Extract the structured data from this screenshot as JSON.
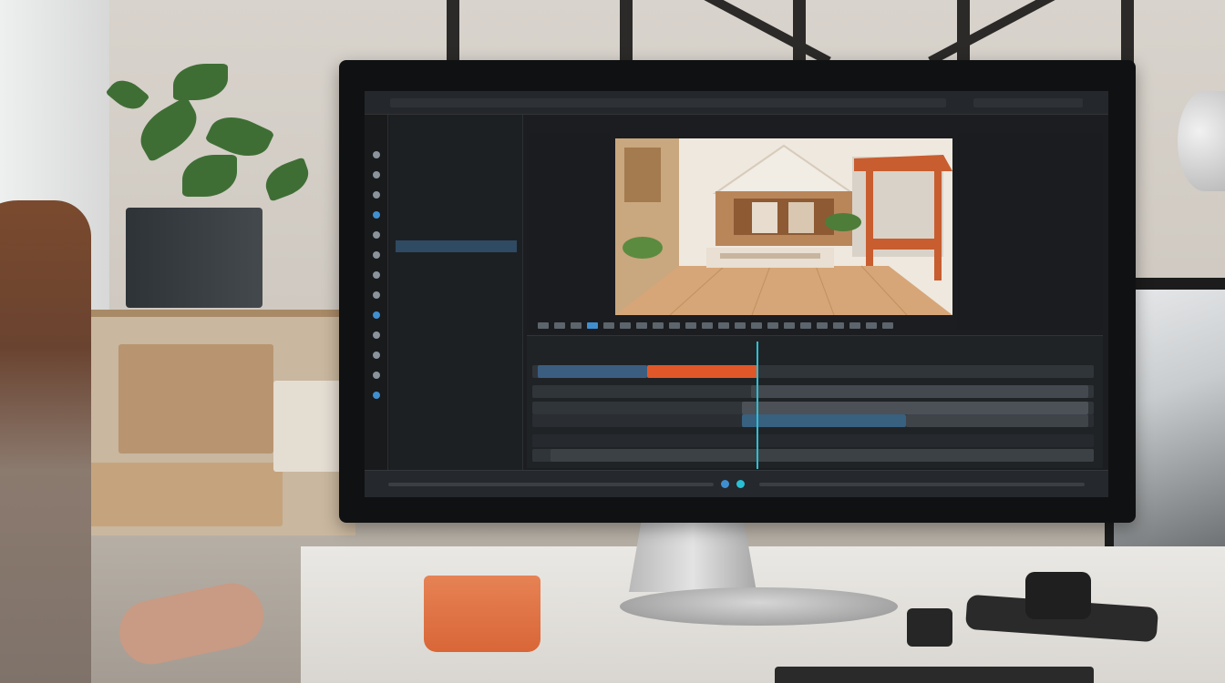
{
  "colors": {
    "accent_blue": "#3f8fd0",
    "clip_orange": "#e0582a",
    "playhead_cyan": "#29c0d6",
    "panel_bg": "#1b1d20"
  },
  "editor": {
    "top_menu": [
      "",
      "",
      "",
      "",
      "",
      ""
    ],
    "left_panel_title": "",
    "left_panel_rows": [
      "",
      "",
      "",
      "",
      "",
      "",
      "",
      "",
      "",
      "",
      "",
      "",
      "",
      "",
      "",
      "",
      "",
      "",
      "",
      "",
      "",
      "",
      "",
      "",
      "",
      "",
      "",
      ""
    ],
    "media_panel_title": "",
    "media_rows": [
      "",
      "",
      "",
      "",
      "",
      "",
      "",
      "",
      "",
      "",
      "",
      "",
      ""
    ],
    "viewer_label": "",
    "right_panel_title": "",
    "right_panel_rows": [
      {
        "k": "",
        "v": ""
      },
      {
        "k": "",
        "v": ""
      },
      {
        "k": "",
        "v": ""
      },
      {
        "k": "",
        "v": ""
      },
      {
        "k": "",
        "v": ""
      },
      {
        "k": "",
        "v": ""
      },
      {
        "k": "",
        "v": ""
      },
      {
        "k": "",
        "v": ""
      },
      {
        "k": "",
        "v": ""
      },
      {
        "k": "",
        "v": ""
      },
      {
        "k": "",
        "v": ""
      },
      {
        "k": "",
        "v": ""
      }
    ],
    "timeline_title": "",
    "status_items": [
      "",
      "",
      "",
      "",
      ""
    ]
  },
  "viewer_scene": "interior-room-render",
  "icons": [
    "wrench-icon",
    "play-icon",
    "pause-icon",
    "playhead-icon"
  ]
}
